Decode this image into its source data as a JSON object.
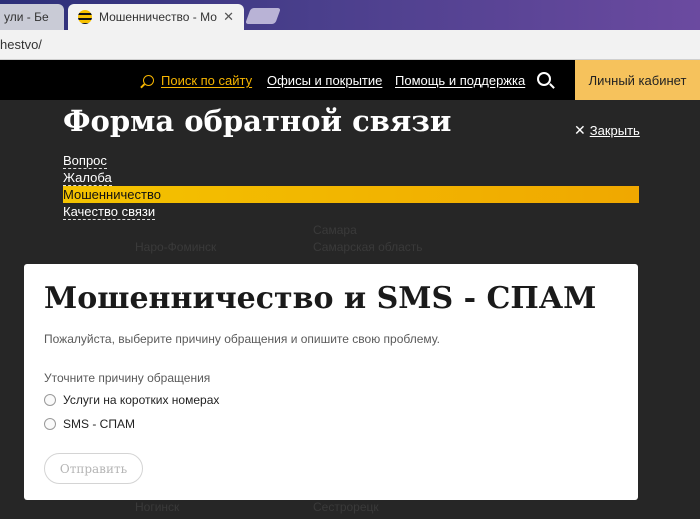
{
  "browser": {
    "tabs": [
      {
        "title": "ули - Бе",
        "active": false
      },
      {
        "title": "Мошенничество - Моб",
        "active": true
      }
    ],
    "url": "hestvo/"
  },
  "nav": {
    "search": "Поиск по сайту",
    "offices": "Офисы и покрытие",
    "help": "Помощь и поддержка",
    "cabinet": "Личный кабинет"
  },
  "form": {
    "title": "Форма обратной связи",
    "close": "Закрыть",
    "menu": [
      {
        "label": "Вопрос",
        "selected": false
      },
      {
        "label": "Жалоба",
        "selected": false
      },
      {
        "label": "Мошенничество",
        "selected": true
      },
      {
        "label": "Качество связи",
        "selected": false
      }
    ]
  },
  "card": {
    "title": "Мошенничество и SMS - СПАМ",
    "description": "Пожалуйста, выберите причину обращения и опишите свою проблему.",
    "subtitle": "Уточните причину обращения",
    "options": [
      "Услуги на коротких номерах",
      "SMS - СПАМ"
    ],
    "submit": "Отправить"
  },
  "background_cities": [
    "Наро-Фоминск",
    "Самарская область",
    "Самара",
    "Ногинск",
    "Сестрорецк"
  ],
  "colors": {
    "accent": "#f6c25c",
    "highlight": "#f4c300",
    "overlay": "#262626"
  },
  "icons": [
    "beeline-favicon",
    "search-icon",
    "close-icon"
  ]
}
